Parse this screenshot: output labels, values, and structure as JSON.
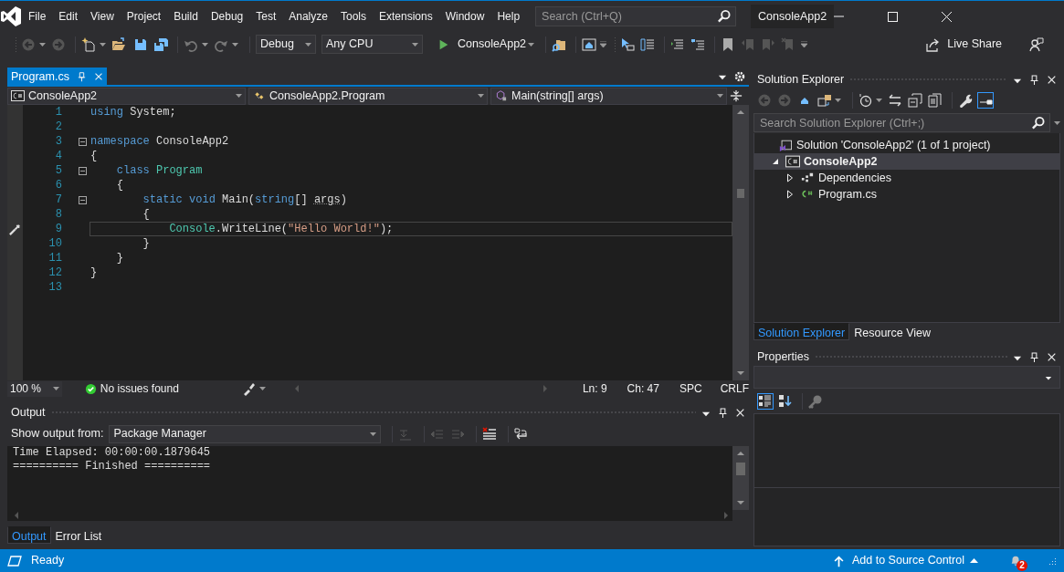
{
  "menu": [
    "File",
    "Edit",
    "View",
    "Project",
    "Build",
    "Debug",
    "Test",
    "Analyze",
    "Tools",
    "Extensions",
    "Window",
    "Help"
  ],
  "search": {
    "placeholder": "Search (Ctrl+Q)"
  },
  "solution_name": "ConsoleApp2",
  "toolbar": {
    "configuration": "Debug",
    "platform": "Any CPU",
    "start": "ConsoleApp2",
    "live_share": "Live Share"
  },
  "document_tabs": [
    {
      "label": "Program.cs",
      "selected": true
    }
  ],
  "nav_bar": [
    {
      "label": "ConsoleApp2",
      "kind": "project"
    },
    {
      "label": "ConsoleApp2.Program",
      "kind": "class"
    },
    {
      "label": "Main(string[] args)",
      "kind": "method"
    }
  ],
  "code_lines": [
    {
      "number": "1",
      "fold": false,
      "current": false,
      "tokens": [
        {
          "text": "using",
          "kind": "keyword"
        },
        {
          "text": " System;",
          "kind": "plain"
        }
      ]
    },
    {
      "number": "2",
      "fold": false,
      "current": false
    },
    {
      "number": "3",
      "fold": true,
      "current": false,
      "tokens": [
        {
          "text": "namespace",
          "kind": "keyword"
        },
        {
          "text": " ConsoleApp2",
          "kind": "plain"
        }
      ]
    },
    {
      "number": "4",
      "fold": false,
      "current": false,
      "tokens": [
        {
          "text": "{",
          "kind": "plain"
        }
      ],
      "children": [
        {
          "number": "5",
          "fold": true,
          "current": false,
          "tokens": [
            {
              "text": "class",
              "kind": "keyword"
            },
            {
              "text": " Program",
              "kind": "type"
            }
          ]
        },
        {
          "number": "6",
          "fold": false,
          "current": false,
          "tokens": [
            {
              "text": "{",
              "kind": "plain"
            }
          ],
          "children": [
            {
              "number": "7",
              "fold": true,
              "current": false,
              "tokens": [
                {
                  "text": "static",
                  "kind": "keyword"
                },
                {
                  "text": " void",
                  "kind": "keyword"
                },
                {
                  "text": " Main(",
                  "kind": "plain"
                },
                {
                  "text": "string",
                  "kind": "keyword"
                },
                {
                  "text": "[] ",
                  "kind": "plain"
                },
                {
                  "text": "args",
                  "kind": "hint"
                },
                {
                  "text": ")",
                  "kind": "plain"
                }
              ]
            },
            {
              "number": "8",
              "fold": false,
              "current": false,
              "tokens": [
                {
                  "text": "{",
                  "kind": "plain"
                }
              ],
              "children": [
                {
                  "number": "9",
                  "fold": false,
                  "current": true,
                  "tokens": [
                    {
                      "text": "Console",
                      "kind": "type"
                    },
                    {
                      "text": ".WriteLine(",
                      "kind": "plain"
                    },
                    {
                      "text": "\"Hello World!\"",
                      "kind": "string"
                    },
                    {
                      "text": ");",
                      "kind": "plain"
                    }
                  ]
                }
              ]
            },
            {
              "number": "10",
              "fold": false,
              "current": false,
              "tokens": [
                {
                  "text": "}",
                  "kind": "plain"
                }
              ]
            }
          ]
        },
        {
          "number": "11",
          "fold": false,
          "current": false,
          "tokens": [
            {
              "text": "}",
              "kind": "plain"
            }
          ]
        }
      ]
    },
    {
      "number": "12",
      "fold": false,
      "current": false,
      "tokens": [
        {
          "text": "}",
          "kind": "plain"
        }
      ]
    },
    {
      "number": "13",
      "fold": false,
      "current": false
    }
  ],
  "editor_status": {
    "zoom": "100 %",
    "issues": "No issues found",
    "line": "Ln: 9",
    "column": "Ch: 47",
    "whitespace": "SPC",
    "line_endings": "CRLF"
  },
  "output": {
    "title": "Output",
    "source_label": "Show output from:",
    "source": "Package Manager",
    "lines": [
      "Time Elapsed: 00:00:00.1879645",
      "========== Finished =========="
    ]
  },
  "bottom_tabs": [
    {
      "label": "Output",
      "selected": true
    },
    {
      "label": "Error List",
      "selected": false
    }
  ],
  "solution_explorer": {
    "title": "Solution Explorer",
    "search": {
      "placeholder": "Search Solution Explorer (Ctrl+;)"
    },
    "tree": [
      {
        "label": "Solution 'ConsoleApp2' (1 of 1 project)",
        "kind": "solution",
        "selected": false,
        "children": [
          {
            "label": "ConsoleApp2",
            "kind": "project",
            "expanded": true,
            "selected": true,
            "children": [
              {
                "label": "Dependencies",
                "kind": "dependencies",
                "expanded": false,
                "selected": false
              },
              {
                "label": "Program.cs",
                "kind": "csharp",
                "expanded": false,
                "selected": false
              }
            ]
          }
        ]
      }
    ]
  },
  "right_tabs": [
    {
      "label": "Solution Explorer",
      "selected": true
    },
    {
      "label": "Resource View",
      "selected": false
    }
  ],
  "properties": {
    "title": "Properties"
  },
  "status_bar": {
    "status": "Ready",
    "source_control": "Add to Source Control",
    "notifications": "2"
  }
}
